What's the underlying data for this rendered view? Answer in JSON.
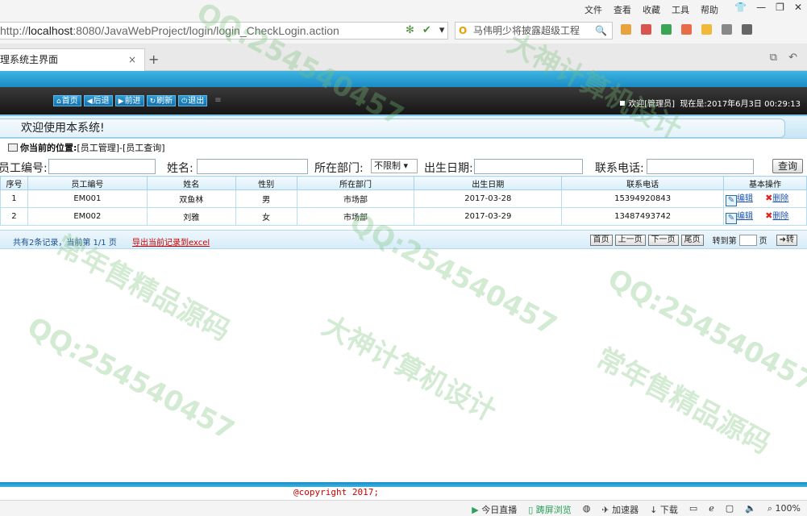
{
  "browser": {
    "menu": [
      "文件",
      "查看",
      "收藏",
      "工具",
      "帮助"
    ],
    "url_prefix": "http://",
    "url_host": "localhost",
    "url_path": ":8080/JavaWebProject/login/login_CheckLogin.action",
    "search_text": "马伟明少将披露超级工程",
    "tab_title": "理系统主界面",
    "tab_close": "×",
    "new_tab": "+",
    "status": {
      "live": "今日直播",
      "screen": "踌屏浏览",
      "accelerate": "加速器",
      "download": "下载",
      "zoom": "100%"
    }
  },
  "nav": {
    "buttons": [
      {
        "icon": "home-icon",
        "label": "首页"
      },
      {
        "icon": "back-icon",
        "label": "后退"
      },
      {
        "icon": "forward-icon",
        "label": "前进"
      },
      {
        "icon": "refresh-icon",
        "label": "刷新"
      },
      {
        "icon": "power-icon",
        "label": "退出"
      }
    ],
    "welcome": "欢迎[管理员]",
    "now_label": "现在是:",
    "datetime": "2017年6月3日  00:29:13"
  },
  "welcome_text": "欢迎使用本系统!",
  "location": {
    "label": "你当前的位置:",
    "path": "[员工管理]-[员工查询]"
  },
  "filters": {
    "emp_no_label": "员工编号:",
    "name_label": "姓名:",
    "dept_label": "所在部门:",
    "dept_value": "不限制",
    "birth_label": "出生日期:",
    "phone_label": "联系电话:",
    "query_button": "查询"
  },
  "table": {
    "headers": [
      "序号",
      "员工编号",
      "姓名",
      "性别",
      "所在部门",
      "出生日期",
      "联系电话",
      "基本操作"
    ],
    "rows": [
      {
        "idx": "1",
        "emp_no": "EM001",
        "name": "双鱼林",
        "gender": "男",
        "dept": "市场部",
        "birth": "2017-03-28",
        "phone": "15394920843"
      },
      {
        "idx": "2",
        "emp_no": "EM002",
        "name": "刘雅",
        "gender": "女",
        "dept": "市场部",
        "birth": "2017-03-29",
        "phone": "13487493742"
      }
    ],
    "edit_label": "编辑",
    "delete_label": "删除"
  },
  "pager": {
    "info": "共有2条记录，当前第 1/1 页",
    "export": "导出当前记录到excel",
    "first": "首页",
    "prev": "上一页",
    "next": "下一页",
    "last": "尾页",
    "goto_label": "转到第",
    "page_unit": "页",
    "go": "转"
  },
  "footer": {
    "copyright": "@copyright 2017;"
  },
  "watermarks": [
    "QQ:254540457",
    "常年售精品源码",
    "大神计算机设计"
  ]
}
